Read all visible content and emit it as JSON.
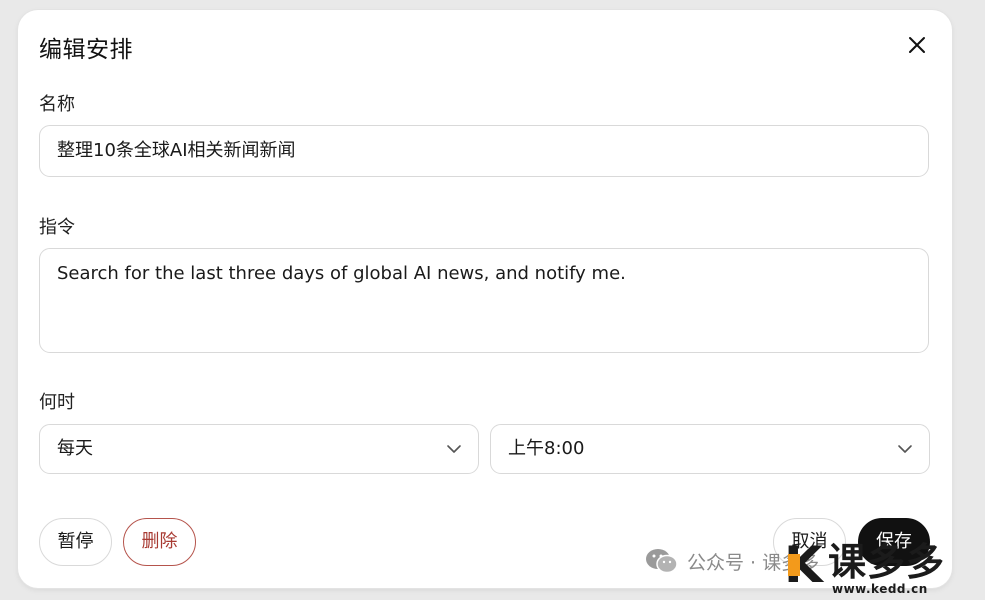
{
  "dialog": {
    "title": "编辑安排",
    "close_icon": "close-icon"
  },
  "name": {
    "label": "名称",
    "value": "整理10条全球AI相关新闻新闻"
  },
  "command": {
    "label": "指令",
    "value": "Search for the last three days of global AI news, and notify me."
  },
  "when": {
    "label": "何时",
    "frequency": "每天",
    "time": "上午8:00",
    "chevron_icon": "chevron-down-icon"
  },
  "actions": {
    "pause": "暂停",
    "delete": "删除",
    "cancel": "取消",
    "save": "保存"
  },
  "watermark": {
    "account": "公众号 · 课多多",
    "icon": "wechat-icon",
    "brand_name": "课多多",
    "brand_url": "www.kedd.cn"
  },
  "colors": {
    "delete_accent": "#a83a32",
    "save_background": "#111111",
    "brand_orange": "#f39a1b"
  }
}
